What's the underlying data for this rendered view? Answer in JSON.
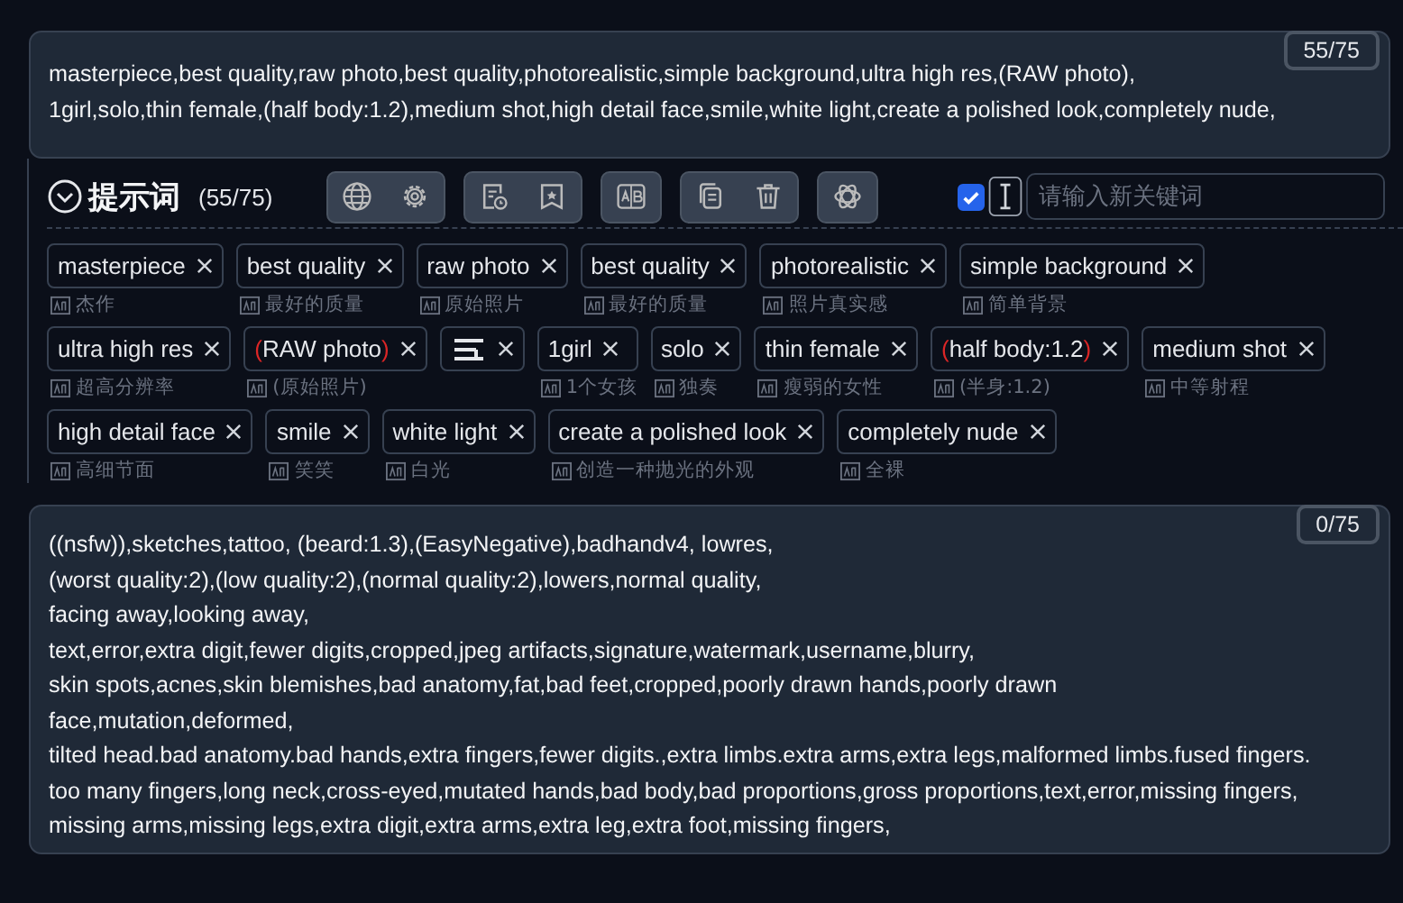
{
  "positive": {
    "counter": "55/75",
    "lines": [
      "masterpiece,best quality,raw photo,best quality,photorealistic,simple background,ultra high res,(RAW photo),",
      "1girl,solo,thin female,(half body:1.2),medium shot,high detail face,smile,white light,create a polished look,completely nude,"
    ]
  },
  "toolbar": {
    "expanded": true,
    "title": "提示词",
    "count": "(55/75)",
    "checkbox": {
      "checked": true
    },
    "keyword_input": {
      "placeholder": "请输入新关键词"
    }
  },
  "tag_rows": [
    [
      {
        "kind": "text",
        "label": "masterpiece",
        "weighted": false,
        "translation": "杰作"
      },
      {
        "kind": "text",
        "label": "best quality",
        "weighted": false,
        "translation": "最好的质量"
      },
      {
        "kind": "text",
        "label": "raw photo",
        "weighted": false,
        "translation": "原始照片"
      },
      {
        "kind": "text",
        "label": "best quality",
        "weighted": false,
        "translation": "最好的质量"
      },
      {
        "kind": "text",
        "label": "photorealistic",
        "weighted": false,
        "translation": "照片真实感"
      },
      {
        "kind": "text",
        "label": "simple background",
        "weighted": false,
        "translation": "简单背景"
      }
    ],
    [
      {
        "kind": "text",
        "label": "ultra high res",
        "weighted": false,
        "translation": "超高分辨率"
      },
      {
        "kind": "text",
        "label": "(RAW photo)",
        "weighted": true,
        "translation": "(原始照片)"
      },
      {
        "kind": "icon"
      },
      {
        "kind": "text",
        "label": "1girl",
        "weighted": false,
        "translation": "1个女孩"
      },
      {
        "kind": "text",
        "label": "solo",
        "weighted": false,
        "translation": "独奏"
      },
      {
        "kind": "text",
        "label": "thin female",
        "weighted": false,
        "translation": "瘦弱的女性"
      },
      {
        "kind": "text",
        "label": "(half body:1.2)",
        "weighted": true,
        "translation": "(半身:1.2)"
      },
      {
        "kind": "text",
        "label": "medium shot",
        "weighted": false,
        "translation": "中等射程"
      }
    ],
    [
      {
        "kind": "text",
        "label": "high detail face",
        "weighted": false,
        "translation": "高细节面"
      },
      {
        "kind": "text",
        "label": "smile",
        "weighted": false,
        "translation": "笑笑"
      },
      {
        "kind": "text",
        "label": "white light",
        "weighted": false,
        "translation": "白光"
      },
      {
        "kind": "text",
        "label": "create a polished look",
        "weighted": false,
        "translation": "创造一种抛光的外观"
      },
      {
        "kind": "text",
        "label": "completely nude",
        "weighted": false,
        "translation": "全裸"
      }
    ]
  ],
  "negative": {
    "counter": "0/75",
    "lines": [
      "((nsfw)),sketches,tattoo, (beard:1.3),(EasyNegative),badhandv4, lowres,",
      "(worst quality:2),(low quality:2),(normal quality:2),lowers,normal quality,",
      "facing away,looking away,",
      "text,error,extra digit,fewer digits,cropped,jpeg artifacts,signature,watermark,username,blurry,",
      "skin spots,acnes,skin blemishes,bad anatomy,fat,bad feet,cropped,poorly drawn hands,poorly drawn",
      "face,mutation,deformed,",
      "tilted head.bad anatomy.bad hands,extra fingers,fewer digits.,extra limbs.extra arms,extra legs,malformed limbs.fused fingers.",
      "too many fingers,long neck,cross-eyed,mutated hands,bad body,bad proportions,gross proportions,text,error,missing fingers,",
      "missing arms,missing legs,extra digit,extra arms,extra leg,extra foot,missing fingers,"
    ]
  }
}
